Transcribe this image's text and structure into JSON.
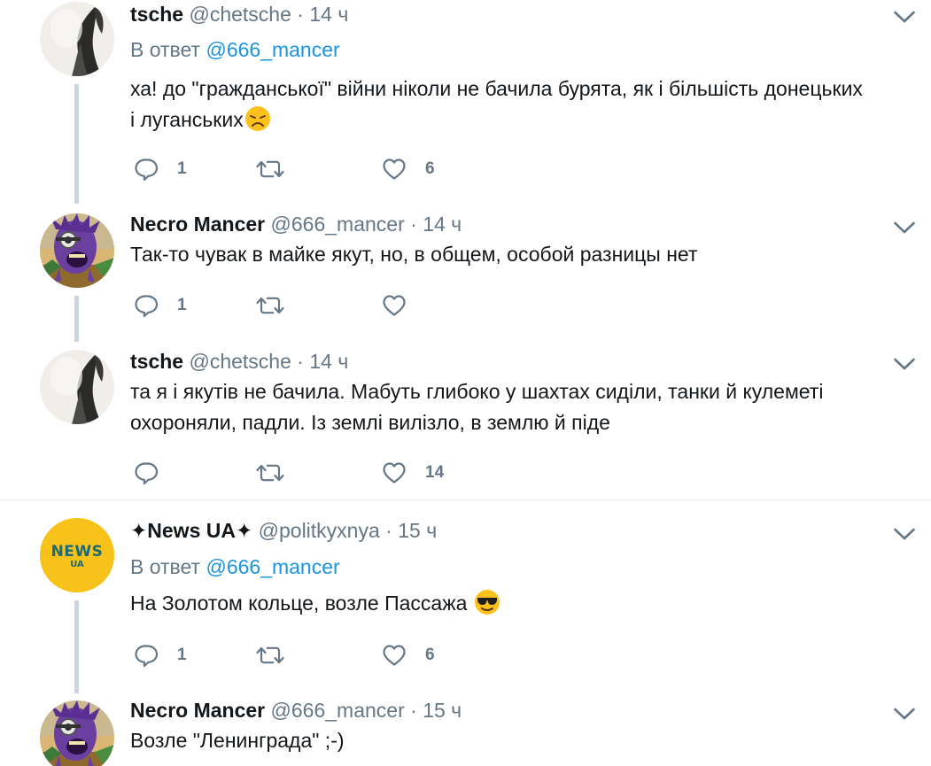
{
  "tweets": [
    {
      "name": "tsche",
      "handle": "@chetsche",
      "dot": "·",
      "time": "14 ч",
      "reply_prefix": "В ответ",
      "reply_to": "@666_mancer",
      "text_lines": [
        "ха! до \"гражданської\" війни ніколи не бачила бурята, як і більшість донецьких",
        "і луганських"
      ],
      "emoji": "disappointed-face-emoji",
      "replies": "1",
      "retweets": "",
      "likes": "6"
    },
    {
      "name": "Necro Mancer",
      "handle": "@666_mancer",
      "dot": "·",
      "time": "14 ч",
      "text_lines": [
        "Так-то чувак в майке якут, но, в общем, особой разницы нет"
      ],
      "replies": "1",
      "retweets": "",
      "likes": ""
    },
    {
      "name": "tsche",
      "handle": "@chetsche",
      "dot": "·",
      "time": "14 ч",
      "text_lines": [
        "та я і якутів не бачила. Мабуть глибоко у шахтах сиділи, танки й кулеметі",
        "охороняли, падли. Із землі вилізло, в землю й піде"
      ],
      "replies": "",
      "retweets": "",
      "likes": "14"
    },
    {
      "name": "✦News UA✦",
      "handle": "@politkyxnya",
      "dot": "·",
      "time": "15 ч",
      "reply_prefix": "В ответ",
      "reply_to": "@666_mancer",
      "text_lines": [
        "На Золотом кольце, возле Пассажа"
      ],
      "emoji": "sunglasses-face-emoji",
      "replies": "1",
      "retweets": "",
      "likes": "6",
      "avatar_text_top": "NEWS",
      "avatar_text_bottom": "UA"
    },
    {
      "name": "Necro Mancer",
      "handle": "@666_mancer",
      "dot": "·",
      "time": "15 ч",
      "text_lines": [
        "Возле \"Ленинграда\" ;-)"
      ]
    }
  ],
  "icons": {
    "reply": "reply-icon",
    "retweet": "retweet-icon",
    "like": "heart-icon",
    "menu": "chevron-down-icon"
  },
  "colors": {
    "text": "#14171a",
    "muted": "#657786",
    "link": "#1b95e0",
    "thread_line": "#ccd6dd",
    "news_avatar_bg": "#f7c21a",
    "news_avatar_text": "#1a6a7a"
  }
}
